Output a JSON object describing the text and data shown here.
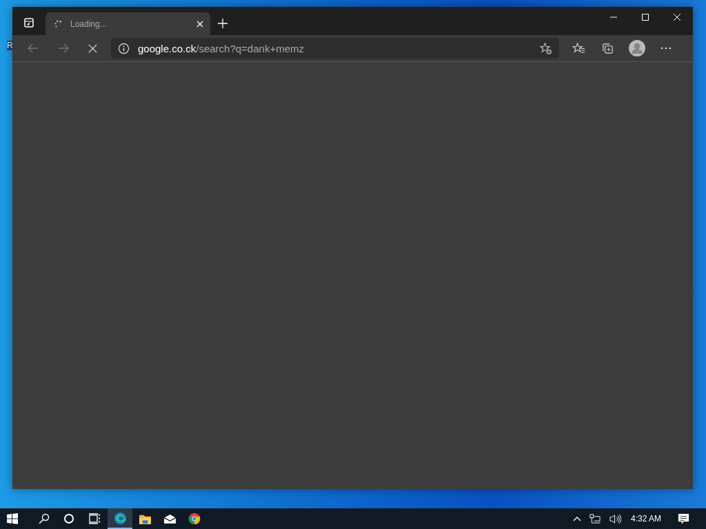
{
  "desktop": {
    "icon_labels": [
      "R"
    ]
  },
  "browser": {
    "tabs": [
      {
        "title": "Loading...",
        "selected": true,
        "loading": true
      }
    ],
    "address": {
      "domain": "google.co.ck",
      "path": "/search?q=dank+memz"
    }
  },
  "taskbar": {
    "apps": [
      {
        "kind": "edge",
        "selected": true
      },
      {
        "kind": "folder",
        "selected": false
      },
      {
        "kind": "mail",
        "selected": false
      },
      {
        "kind": "chrome",
        "selected": false
      }
    ],
    "time": "4:32 AM"
  }
}
